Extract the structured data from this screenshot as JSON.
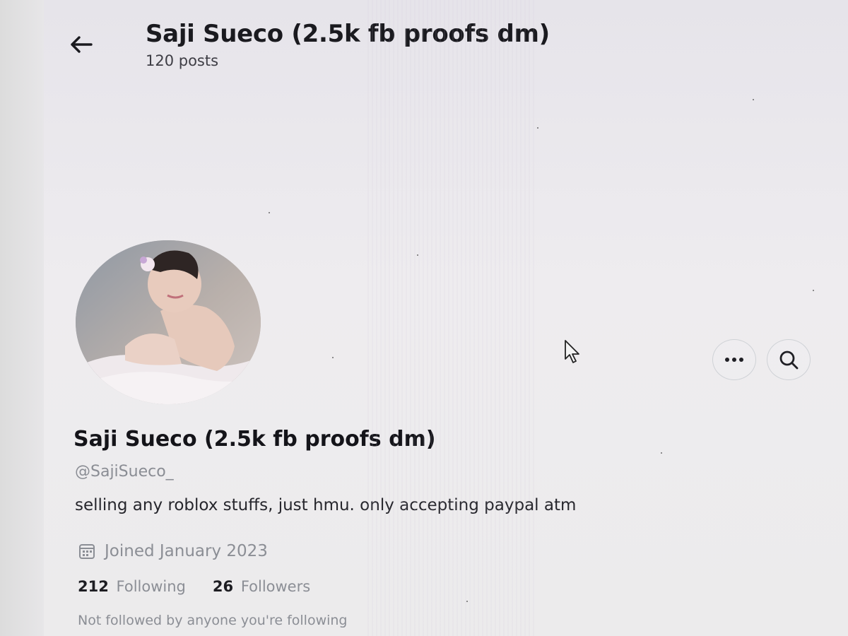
{
  "header": {
    "back_icon": "arrow-left-icon",
    "title": "Saji Sueco (2.5k fb proofs dm)",
    "post_count": "120 posts"
  },
  "profile": {
    "avatar": "profile-photo",
    "display_name": "Saji Sueco (2.5k fb proofs dm)",
    "handle": "@SajiSueco_",
    "bio": "selling any roblox stuffs, just hmu. only accepting paypal atm",
    "joined_icon": "calendar-icon",
    "joined": "Joined January 2023",
    "following_count": "212",
    "following_label": "Following",
    "followers_count": "26",
    "followers_label": "Followers",
    "not_followed_note": "Not followed by anyone you're following"
  },
  "actions": {
    "more_icon": "more-options-icon",
    "search_icon": "search-icon"
  },
  "colors": {
    "text_primary": "#141419",
    "text_secondary": "#8b8e95",
    "button_border": "#cfd2d6"
  }
}
